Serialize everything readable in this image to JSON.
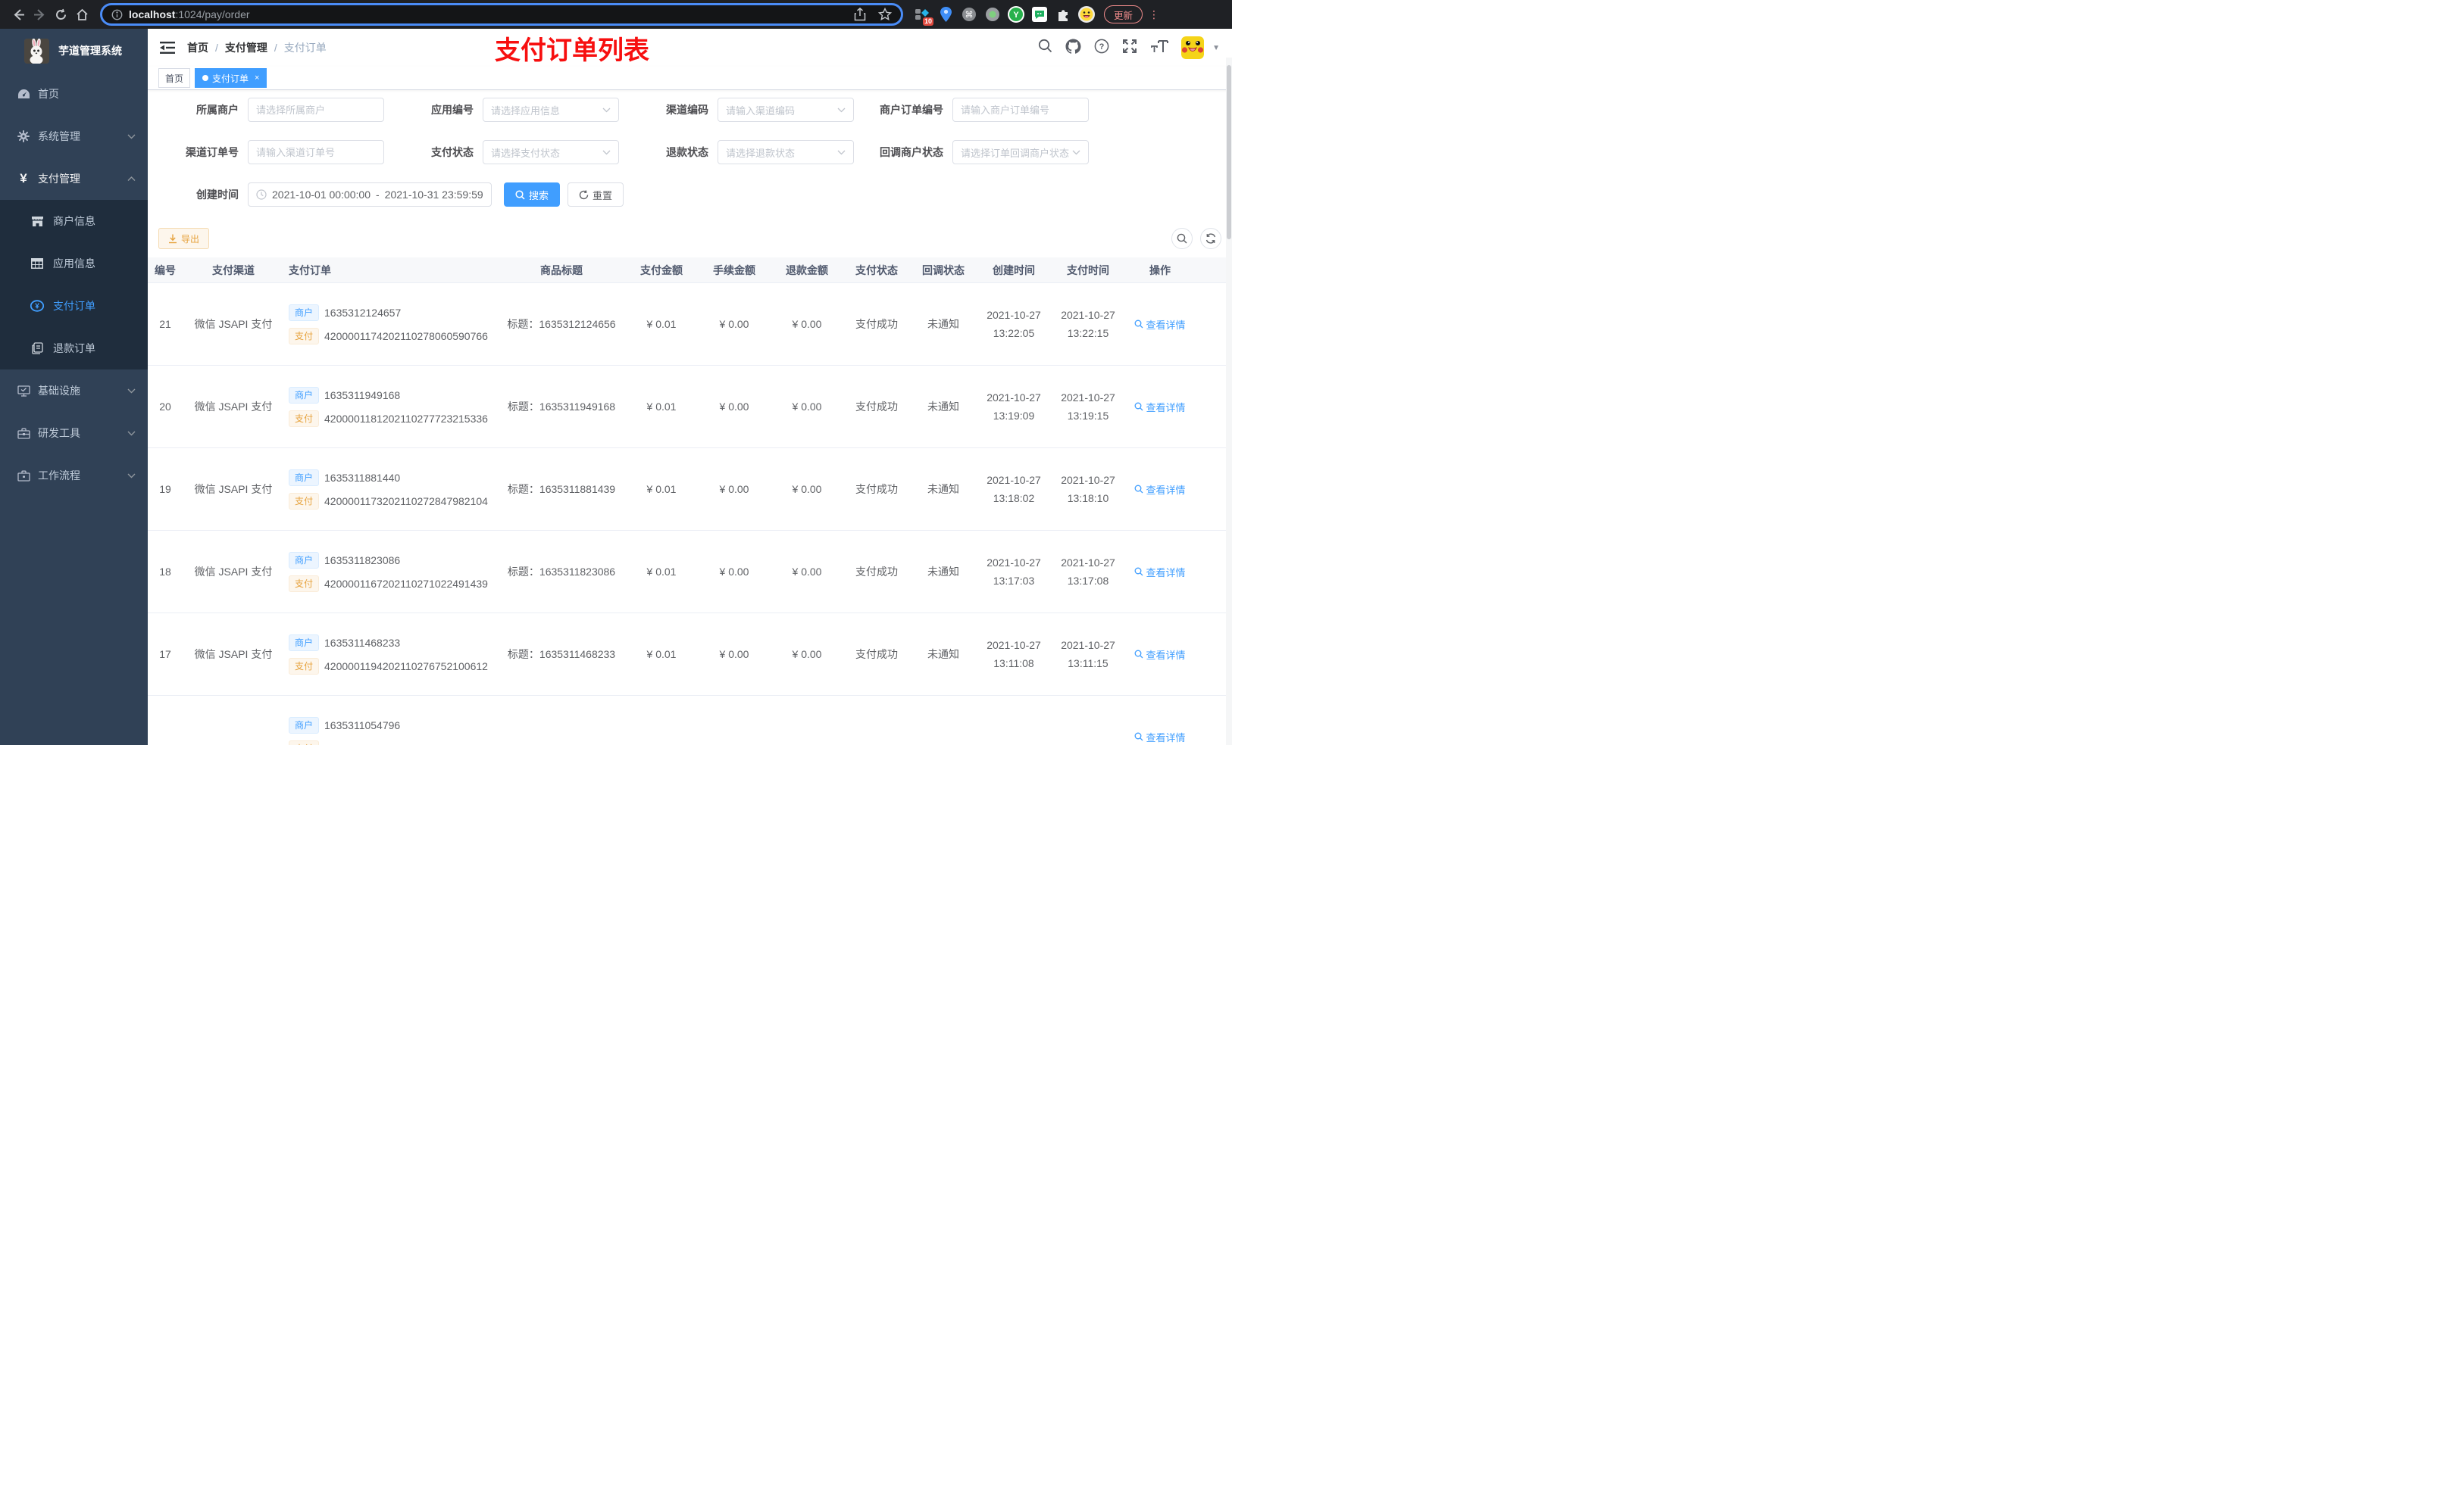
{
  "browser": {
    "url_host": "localhost",
    "url_path": ":1024/pay/order",
    "ext_badge": "10",
    "update_label": "更新"
  },
  "sidebar": {
    "title": "芋道管理系统",
    "items": [
      {
        "label": "首页"
      },
      {
        "label": "系统管理"
      },
      {
        "label": "支付管理"
      },
      {
        "label": "基础设施"
      },
      {
        "label": "研发工具"
      },
      {
        "label": "工作流程"
      }
    ],
    "submenu": [
      {
        "label": "商户信息"
      },
      {
        "label": "应用信息"
      },
      {
        "label": "支付订单"
      },
      {
        "label": "退款订单"
      }
    ]
  },
  "header": {
    "breadcrumb": [
      "首页",
      "支付管理",
      "支付订单"
    ],
    "annotation": "支付订单列表"
  },
  "tags": {
    "home": "首页",
    "active": "支付订单",
    "close": "×"
  },
  "filters": {
    "merchant": {
      "label": "所属商户",
      "placeholder": "请选择所属商户"
    },
    "app": {
      "label": "应用编号",
      "placeholder": "请选择应用信息"
    },
    "channel_code": {
      "label": "渠道编码",
      "placeholder": "请输入渠道编码"
    },
    "merchant_order_no": {
      "label": "商户订单编号",
      "placeholder": "请输入商户订单编号"
    },
    "channel_order_no": {
      "label": "渠道订单号",
      "placeholder": "请输入渠道订单号"
    },
    "pay_status": {
      "label": "支付状态",
      "placeholder": "请选择支付状态"
    },
    "refund_status": {
      "label": "退款状态",
      "placeholder": "请选择退款状态"
    },
    "callback_status": {
      "label": "回调商户状态",
      "placeholder": "请选择订单回调商户状态"
    },
    "create_time": {
      "label": "创建时间",
      "start": "2021-10-01 00:00:00",
      "separator": "-",
      "end": "2021-10-31 23:59:59"
    },
    "search_label": "搜索",
    "reset_label": "重置"
  },
  "toolbar": {
    "export_label": "导出"
  },
  "table": {
    "columns": [
      "编号",
      "支付渠道",
      "支付订单",
      "商品标题",
      "支付金额",
      "手续金额",
      "退款金额",
      "支付状态",
      "回调状态",
      "创建时间",
      "支付时间",
      "操作"
    ],
    "merchant_tag": "商户",
    "pay_tag": "支付",
    "action_label": "查看详情",
    "rows": [
      {
        "id": "21",
        "channel": "微信 JSAPI 支付",
        "merchant_no": "1635312124657",
        "pay_no": "4200001174202110278060590766",
        "title": "标题：1635312124656",
        "amount": "¥ 0.01",
        "fee": "¥ 0.00",
        "refund": "¥ 0.00",
        "status": "支付成功",
        "notify": "未通知",
        "created_date": "2021-10-27",
        "created_time": "13:22:05",
        "paid_date": "2021-10-27",
        "paid_time": "13:22:15"
      },
      {
        "id": "20",
        "channel": "微信 JSAPI 支付",
        "merchant_no": "1635311949168",
        "pay_no": "4200001181202110277723215336",
        "title": "标题：1635311949168",
        "amount": "¥ 0.01",
        "fee": "¥ 0.00",
        "refund": "¥ 0.00",
        "status": "支付成功",
        "notify": "未通知",
        "created_date": "2021-10-27",
        "created_time": "13:19:09",
        "paid_date": "2021-10-27",
        "paid_time": "13:19:15"
      },
      {
        "id": "19",
        "channel": "微信 JSAPI 支付",
        "merchant_no": "1635311881440",
        "pay_no": "4200001173202110272847982104",
        "title": "标题：1635311881439",
        "amount": "¥ 0.01",
        "fee": "¥ 0.00",
        "refund": "¥ 0.00",
        "status": "支付成功",
        "notify": "未通知",
        "created_date": "2021-10-27",
        "created_time": "13:18:02",
        "paid_date": "2021-10-27",
        "paid_time": "13:18:10"
      },
      {
        "id": "18",
        "channel": "微信 JSAPI 支付",
        "merchant_no": "1635311823086",
        "pay_no": "4200001167202110271022491439",
        "title": "标题：1635311823086",
        "amount": "¥ 0.01",
        "fee": "¥ 0.00",
        "refund": "¥ 0.00",
        "status": "支付成功",
        "notify": "未通知",
        "created_date": "2021-10-27",
        "created_time": "13:17:03",
        "paid_date": "2021-10-27",
        "paid_time": "13:17:08"
      },
      {
        "id": "17",
        "channel": "微信 JSAPI 支付",
        "merchant_no": "1635311468233",
        "pay_no": "4200001194202110276752100612",
        "title": "标题：1635311468233",
        "amount": "¥ 0.01",
        "fee": "¥ 0.00",
        "refund": "¥ 0.00",
        "status": "支付成功",
        "notify": "未通知",
        "created_date": "2021-10-27",
        "created_time": "13:11:08",
        "paid_date": "2021-10-27",
        "paid_time": "13:11:15"
      },
      {
        "merchant_no": "1635311054796"
      }
    ]
  }
}
